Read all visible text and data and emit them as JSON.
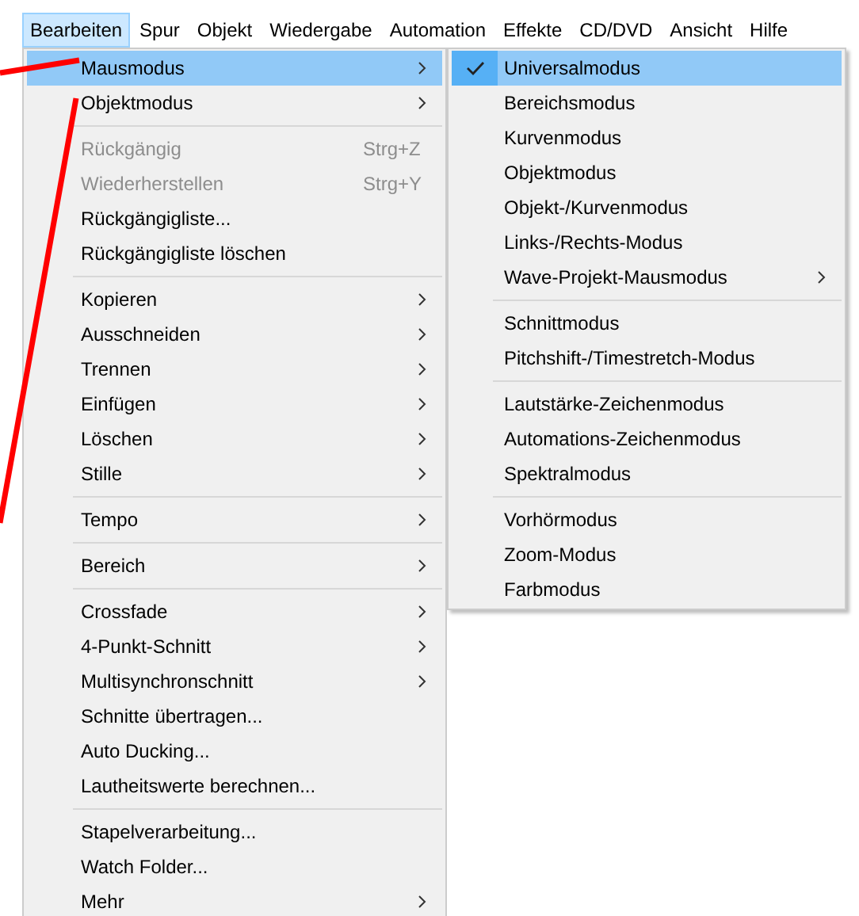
{
  "menubar": [
    {
      "label": "Bearbeiten",
      "selected": true
    },
    {
      "label": "Spur",
      "selected": false
    },
    {
      "label": "Objekt",
      "selected": false
    },
    {
      "label": "Wiedergabe",
      "selected": false
    },
    {
      "label": "Automation",
      "selected": false
    },
    {
      "label": "Effekte",
      "selected": false
    },
    {
      "label": "CD/DVD",
      "selected": false
    },
    {
      "label": "Ansicht",
      "selected": false
    },
    {
      "label": "Hilfe",
      "selected": false
    }
  ],
  "menu": {
    "sections": [
      [
        {
          "label": "Mausmodus",
          "submenu": true,
          "disabled": false,
          "highlighted": true
        },
        {
          "label": "Objektmodus",
          "submenu": true,
          "disabled": false,
          "highlighted": false
        }
      ],
      [
        {
          "label": "Rückgängig",
          "shortcut": "Strg+Z",
          "submenu": false,
          "disabled": true,
          "highlighted": false
        },
        {
          "label": "Wiederherstellen",
          "shortcut": "Strg+Y",
          "submenu": false,
          "disabled": true,
          "highlighted": false
        },
        {
          "label": "Rückgängigliste...",
          "submenu": false,
          "disabled": false,
          "highlighted": false
        },
        {
          "label": "Rückgängigliste löschen",
          "submenu": false,
          "disabled": false,
          "highlighted": false
        }
      ],
      [
        {
          "label": "Kopieren",
          "submenu": true,
          "disabled": false,
          "highlighted": false
        },
        {
          "label": "Ausschneiden",
          "submenu": true,
          "disabled": false,
          "highlighted": false
        },
        {
          "label": "Trennen",
          "submenu": true,
          "disabled": false,
          "highlighted": false
        },
        {
          "label": "Einfügen",
          "submenu": true,
          "disabled": false,
          "highlighted": false
        },
        {
          "label": "Löschen",
          "submenu": true,
          "disabled": false,
          "highlighted": false
        },
        {
          "label": "Stille",
          "submenu": true,
          "disabled": false,
          "highlighted": false
        }
      ],
      [
        {
          "label": "Tempo",
          "submenu": true,
          "disabled": false,
          "highlighted": false
        }
      ],
      [
        {
          "label": "Bereich",
          "submenu": true,
          "disabled": false,
          "highlighted": false
        }
      ],
      [
        {
          "label": "Crossfade",
          "submenu": true,
          "disabled": false,
          "highlighted": false
        },
        {
          "label": "4-Punkt-Schnitt",
          "submenu": true,
          "disabled": false,
          "highlighted": false
        },
        {
          "label": "Multisynchronschnitt",
          "submenu": true,
          "disabled": false,
          "highlighted": false
        },
        {
          "label": "Schnitte übertragen...",
          "submenu": false,
          "disabled": false,
          "highlighted": false
        },
        {
          "label": "Auto Ducking...",
          "submenu": false,
          "disabled": false,
          "highlighted": false
        },
        {
          "label": "Lautheitswerte berechnen...",
          "submenu": false,
          "disabled": false,
          "highlighted": false
        }
      ],
      [
        {
          "label": "Stapelverarbeitung...",
          "submenu": false,
          "disabled": false,
          "highlighted": false
        },
        {
          "label": "Watch Folder...",
          "submenu": false,
          "disabled": false,
          "highlighted": false
        },
        {
          "label": "Mehr",
          "submenu": true,
          "disabled": false,
          "highlighted": false
        }
      ]
    ]
  },
  "submenu": {
    "sections": [
      [
        {
          "label": "Universalmodus",
          "checked": true,
          "submenu": false,
          "highlighted": true
        },
        {
          "label": "Bereichsmodus",
          "checked": false,
          "submenu": false,
          "highlighted": false
        },
        {
          "label": "Kurvenmodus",
          "checked": false,
          "submenu": false,
          "highlighted": false
        },
        {
          "label": "Objektmodus",
          "checked": false,
          "submenu": false,
          "highlighted": false
        },
        {
          "label": "Objekt-/Kurvenmodus",
          "checked": false,
          "submenu": false,
          "highlighted": false
        },
        {
          "label": "Links-/Rechts-Modus",
          "checked": false,
          "submenu": false,
          "highlighted": false
        },
        {
          "label": "Wave-Projekt-Mausmodus",
          "checked": false,
          "submenu": true,
          "highlighted": false
        }
      ],
      [
        {
          "label": "Schnittmodus",
          "checked": false,
          "submenu": false,
          "highlighted": false
        },
        {
          "label": "Pitchshift-/Timestretch-Modus",
          "checked": false,
          "submenu": false,
          "highlighted": false
        }
      ],
      [
        {
          "label": "Lautstärke-Zeichenmodus",
          "checked": false,
          "submenu": false,
          "highlighted": false
        },
        {
          "label": "Automations-Zeichenmodus",
          "checked": false,
          "submenu": false,
          "highlighted": false
        },
        {
          "label": "Spektralmodus",
          "checked": false,
          "submenu": false,
          "highlighted": false
        }
      ],
      [
        {
          "label": "Vorhörmodus",
          "checked": false,
          "submenu": false,
          "highlighted": false
        },
        {
          "label": "Zoom-Modus",
          "checked": false,
          "submenu": false,
          "highlighted": false
        },
        {
          "label": "Farbmodus",
          "checked": false,
          "submenu": false,
          "highlighted": false
        }
      ]
    ]
  }
}
